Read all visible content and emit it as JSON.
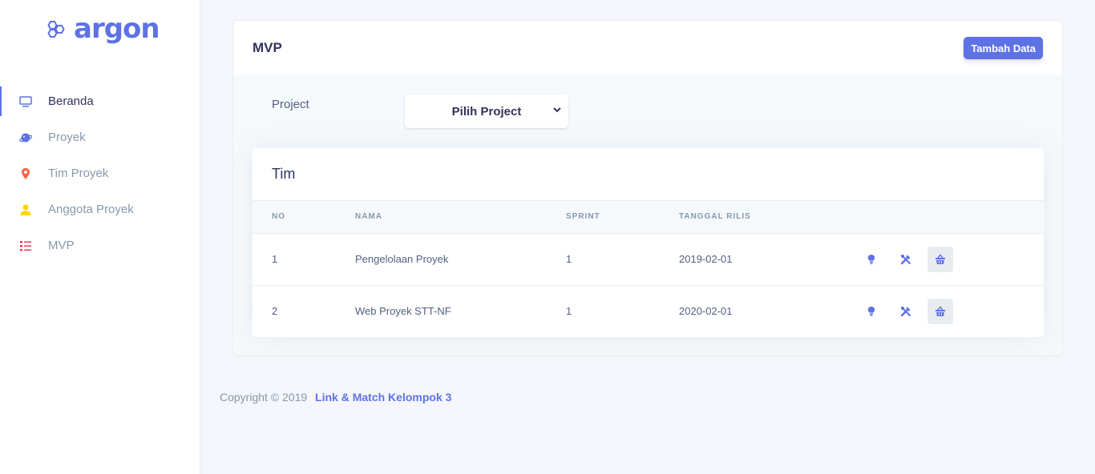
{
  "brand": {
    "name": "argon"
  },
  "sidebar": {
    "items": [
      {
        "label": "Beranda",
        "icon": "monitor-icon",
        "color": "#5e72e4",
        "active": true
      },
      {
        "label": "Proyek",
        "icon": "planet-icon",
        "color": "#5e72e4"
      },
      {
        "label": "Tim Proyek",
        "icon": "pin-icon",
        "color": "#fb6340"
      },
      {
        "label": "Anggota Proyek",
        "icon": "user-icon",
        "color": "#ffd600"
      },
      {
        "label": "MVP",
        "icon": "list-icon",
        "color": "#f5365c"
      }
    ]
  },
  "page": {
    "title": "MVP",
    "add_button": "Tambah Data",
    "filter_label": "Project",
    "select_value": "Pilih Project"
  },
  "table": {
    "title": "Tim",
    "headers": [
      "No",
      "Nama",
      "Sprint",
      "Tanggal Rilis"
    ],
    "rows": [
      {
        "no": "1",
        "nama": "Pengelolaan Proyek",
        "sprint": "1",
        "tanggal": "2019-02-01"
      },
      {
        "no": "2",
        "nama": "Web Proyek STT-NF",
        "sprint": "1",
        "tanggal": "2020-02-01"
      }
    ],
    "action_icons": [
      "bulb-icon",
      "tools-icon",
      "basket-icon"
    ]
  },
  "footer": {
    "copyright": "Copyright © 2019",
    "link": "Link & Match Kelompok 3"
  },
  "colors": {
    "primary": "#5e72e4",
    "background": "#f4f6fb"
  }
}
